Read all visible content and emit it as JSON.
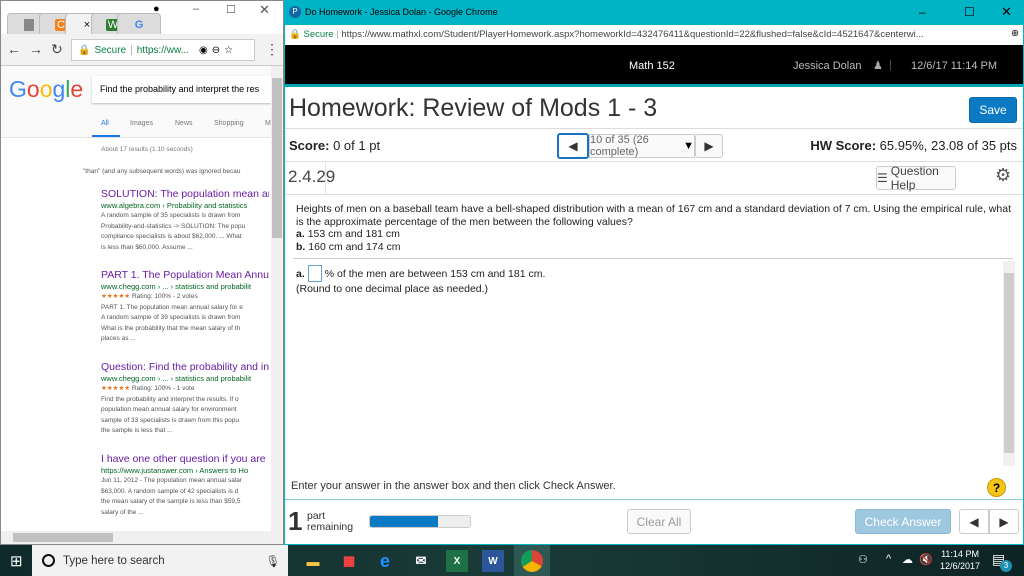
{
  "left_window": {
    "tabs": [
      {
        "icon": "calculator-icon"
      },
      {
        "icon": "chegg-icon",
        "label": "C"
      },
      {
        "icon": "close-icon",
        "label": "×"
      },
      {
        "icon": "course-icon",
        "label": "W"
      },
      {
        "icon": "google-icon",
        "label": "G"
      }
    ],
    "address": {
      "secure": "Secure",
      "url": "https://ww..."
    },
    "logo": "Google",
    "search_value": "Find the probability and interpret the res",
    "nav": [
      "All",
      "Images",
      "News",
      "Shopping",
      "M"
    ],
    "result_stats": "About 17 results (1.10 seconds)",
    "ignored_note": "\"than\" (and any subsequent words) was ignored becau",
    "results": [
      {
        "title": "SOLUTION: The population mean an",
        "url": "www.algebra.com › Probability and statistics",
        "rating": "",
        "snippet": [
          "A random sample of 35 specialists is drawn from",
          "Probability-and-statistics -> SOLUTION: The popu",
          "compliance specialists is about $62,000. ... What",
          "is less than $60,000. Assume ..."
        ]
      },
      {
        "title": "PART 1. The Population Mean Annu",
        "url": "www.chegg.com › ... › statistics and probabilit",
        "rating": "Rating: 100% - 2 votes",
        "snippet": [
          "PART 1. The population mean annual salary for e",
          "A random sample of 39 specialists is drawn from",
          "What is the probability that the mean salary of th",
          "places as ..."
        ]
      },
      {
        "title": "Question: Find the probability and in",
        "url": "www.chegg.com › ... › statistics and probabilit",
        "rating": "Rating: 100% - 1 vote",
        "snippet": [
          "Find the probability and interpret the results. If o",
          "population mean annual salary for environment",
          "sample of 33 specialists is drawn from this popu",
          "the sample is less that ..."
        ]
      },
      {
        "title": "I have one other question if you are",
        "url": "https://www.justanswer.com › Answers to Ho",
        "rating": "",
        "snippet": [
          "Jun 11, 2012 - The population mean annual salar",
          "$63,000. A random sample of 42 specialists is d",
          "the mean salary of the sample is less than $59,5",
          "salary of the ..."
        ]
      }
    ],
    "stars": "★★★★★"
  },
  "right_window": {
    "title": "Do Homework - Jessica Dolan - Google Chrome",
    "secure": "Secure",
    "url": "https://www.mathxl.com/Student/PlayerHomework.aspx?homeworkId=432476411&questionId=22&flushed=false&cId=4521647&centerwi...",
    "course": "Math 152",
    "user": "Jessica Dolan",
    "datetime": "12/6/17 11:14 PM",
    "hw_title": "Homework: Review of Mods 1 - 3",
    "save": "Save",
    "score_label": "Score:",
    "score_value": "0 of 1 pt",
    "question_nav": "10 of 35 (26 complete)",
    "hw_score_label": "HW Score:",
    "hw_score_value": "65.95%, 23.08 of 35 pts",
    "question_id": "2.4.29",
    "question_help": "Question Help",
    "question_text": "Heights of men on a baseball team have a bell-shaped distribution with a mean of 167 cm and a standard deviation of 7 cm. Using the empirical rule, what is the approximate percentage of the men between the following values?",
    "parts": [
      {
        "label": "a.",
        "text": "153 cm and 181 cm"
      },
      {
        "label": "b.",
        "text": "160 cm and 174 cm"
      }
    ],
    "answer_label": "a.",
    "answer_value": "",
    "answer_text": "% of the men are between 153 cm and 181 cm.",
    "round_note": "(Round to one decimal place as needed.)",
    "instruction": "Enter your answer in the answer box and then click Check Answer.",
    "parts_remaining": "1",
    "part_word": "part",
    "remaining_word": "remaining",
    "progress_percent": 68,
    "clear_all": "Clear All",
    "check_answer": "Check Answer",
    "accent": "#0a7bc2"
  },
  "taskbar": {
    "search_placeholder": "Type here to search",
    "time": "11:14 PM",
    "date": "12/6/2017",
    "notifications": "3"
  }
}
